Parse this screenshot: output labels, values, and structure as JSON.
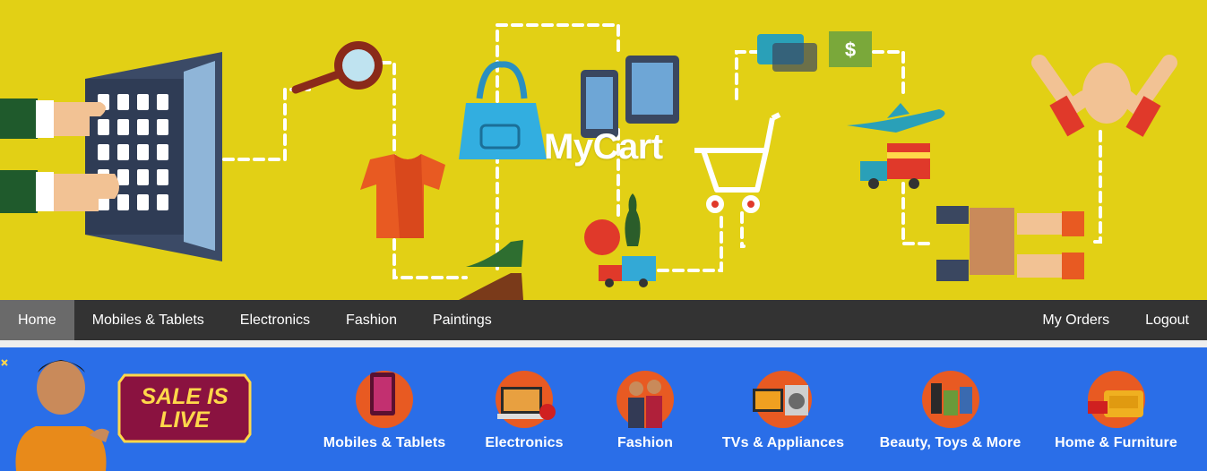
{
  "brand": {
    "name": "MyCart"
  },
  "nav": {
    "left": [
      "Home",
      "Mobiles & Tablets",
      "Electronics",
      "Fashion",
      "Paintings"
    ],
    "right": [
      "My Orders",
      "Logout"
    ],
    "active": "Home"
  },
  "promo": {
    "sale_line1": "SALE IS",
    "sale_line2": "LIVE",
    "categories": [
      "Mobiles & Tablets",
      "Electronics",
      "Fashion",
      "TVs & Appliances",
      "Beauty, Toys & More",
      "Home & Furniture"
    ]
  },
  "colors": {
    "hero_bg": "#e2d015",
    "nav_bg": "#333333",
    "nav_active": "#6a6a6a",
    "promo_bg": "#2a6ee8",
    "sale_text": "#ffd84a"
  }
}
